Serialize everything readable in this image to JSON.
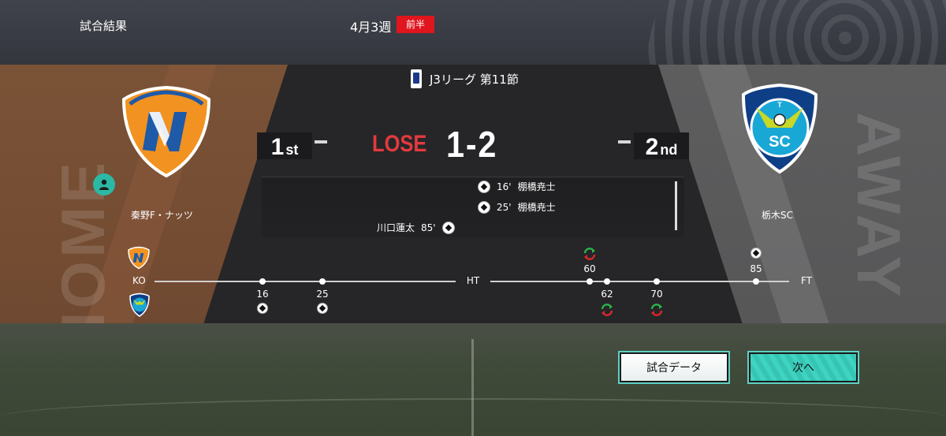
{
  "header": {
    "title": "試合結果",
    "week": "4月3週",
    "half_badge": "前半",
    "accent_color": "#e0151d"
  },
  "league": {
    "name": "J3リーグ 第11節",
    "logo_icon": "j-league-logo-icon"
  },
  "home": {
    "name": "秦野F・ナッツ",
    "rank_num": "1",
    "rank_suffix": "st",
    "crest_icon": "orange-n-shield-crest",
    "player_icon": "user-icon",
    "watermark": "HOME"
  },
  "away": {
    "name": "栃木SC",
    "rank_num": "2",
    "rank_suffix": "nd",
    "crest_icon": "tochigi-sc-crest",
    "watermark": "AWAY"
  },
  "result": {
    "label": "LOSE",
    "score": "1-2",
    "label_color": "#e23a3e"
  },
  "goals": [
    {
      "side": "away",
      "minute": "16'",
      "scorer": "棚橋尭士"
    },
    {
      "side": "away",
      "minute": "25'",
      "scorer": "棚橋尭士"
    },
    {
      "side": "home",
      "minute": "85'",
      "scorer": "川口蓮太"
    }
  ],
  "timeline": {
    "start": "KO",
    "half": "HT",
    "end": "FT",
    "home_events": [
      {
        "minute": "60",
        "type": "substitution"
      },
      {
        "minute": "85",
        "type": "goal"
      }
    ],
    "away_events": [
      {
        "minute": "16",
        "type": "goal"
      },
      {
        "minute": "25",
        "type": "goal"
      },
      {
        "minute": "62",
        "type": "substitution"
      },
      {
        "minute": "70",
        "type": "substitution"
      }
    ]
  },
  "buttons": {
    "match_data": "試合データ",
    "next": "次へ",
    "accent_color": "#3fd3c2"
  }
}
